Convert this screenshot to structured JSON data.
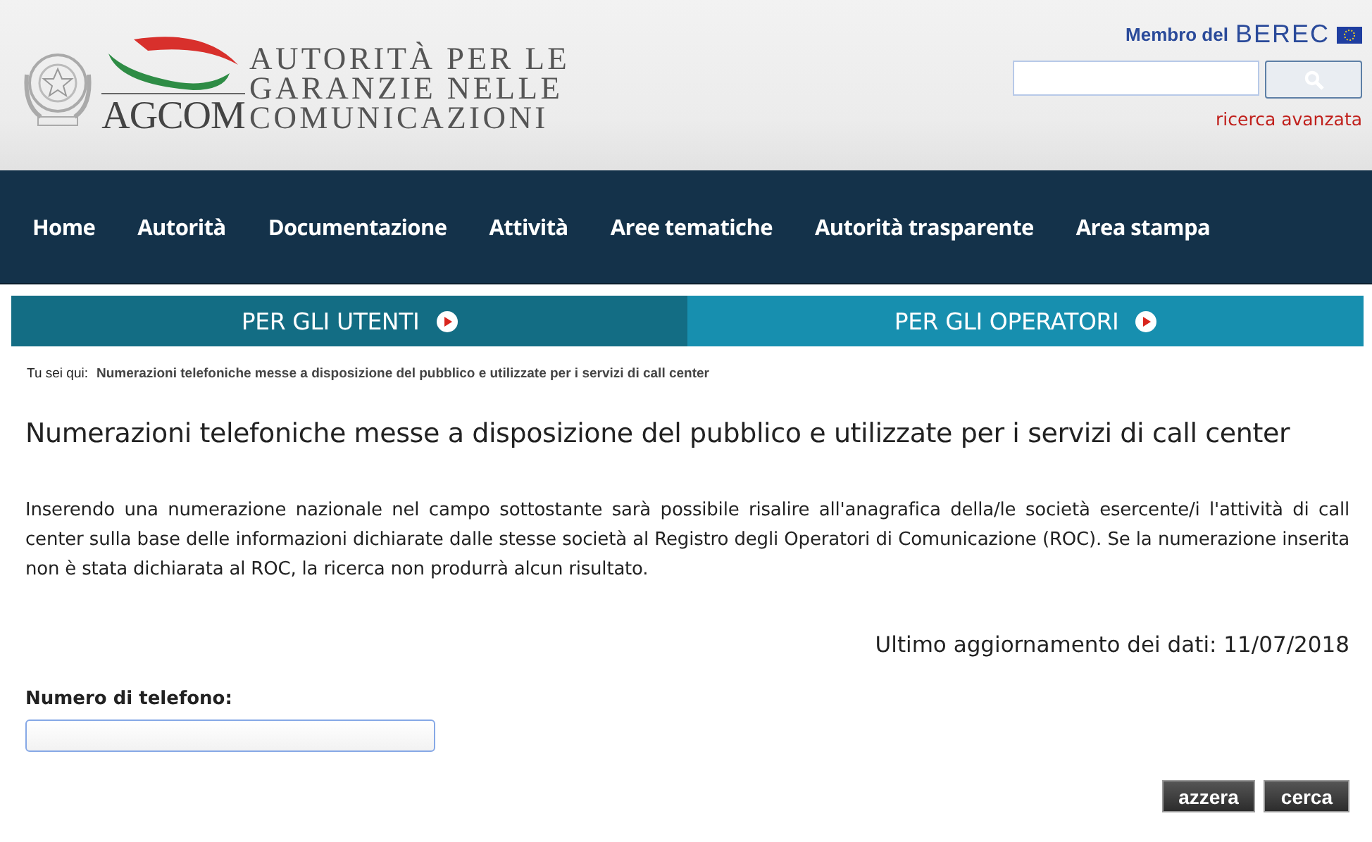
{
  "header": {
    "logo_text": "AGCOM",
    "title_lines": [
      "AUTORITÀ PER LE",
      "GARANZIE NELLE",
      "COMUNICAZIONI"
    ],
    "membership": {
      "label": "Membro del",
      "brand": "BEREC"
    },
    "advanced_search": "ricerca avanzata"
  },
  "nav": [
    "Home",
    "Autorità",
    "Documentazione",
    "Attività",
    "Aree tematiche",
    "Autorità trasparente",
    "Area stampa"
  ],
  "audience_tabs": [
    {
      "label": "PER GLI UTENTI",
      "color": "#136d84"
    },
    {
      "label": "PER GLI OPERATORI",
      "color": "#178faf"
    }
  ],
  "breadcrumb": {
    "label": "Tu sei qui:",
    "current": "Numerazioni telefoniche messe a disposizione del pubblico e utilizzate per i servizi di call center"
  },
  "page_title": "Numerazioni telefoniche messe a disposizione del pubblico e utilizzate per i servizi di call center",
  "intro": "Inserendo una numerazione nazionale nel campo sottostante sarà possibile risalire all'anagrafica della/le società esercente/i l'attività di call center sulla base delle informazioni dichiarate dalle stesse società al Registro degli Operatori di Comunicazione (ROC). Se la numerazione inserita non è stata dichiarata al ROC, la ricerca non produrrà alcun risultato.",
  "last_update": "Ultimo aggiornamento dei dati: 11/07/2018",
  "form": {
    "label": "Numero di telefono:",
    "buttons": [
      "azzera",
      "cerca"
    ]
  }
}
